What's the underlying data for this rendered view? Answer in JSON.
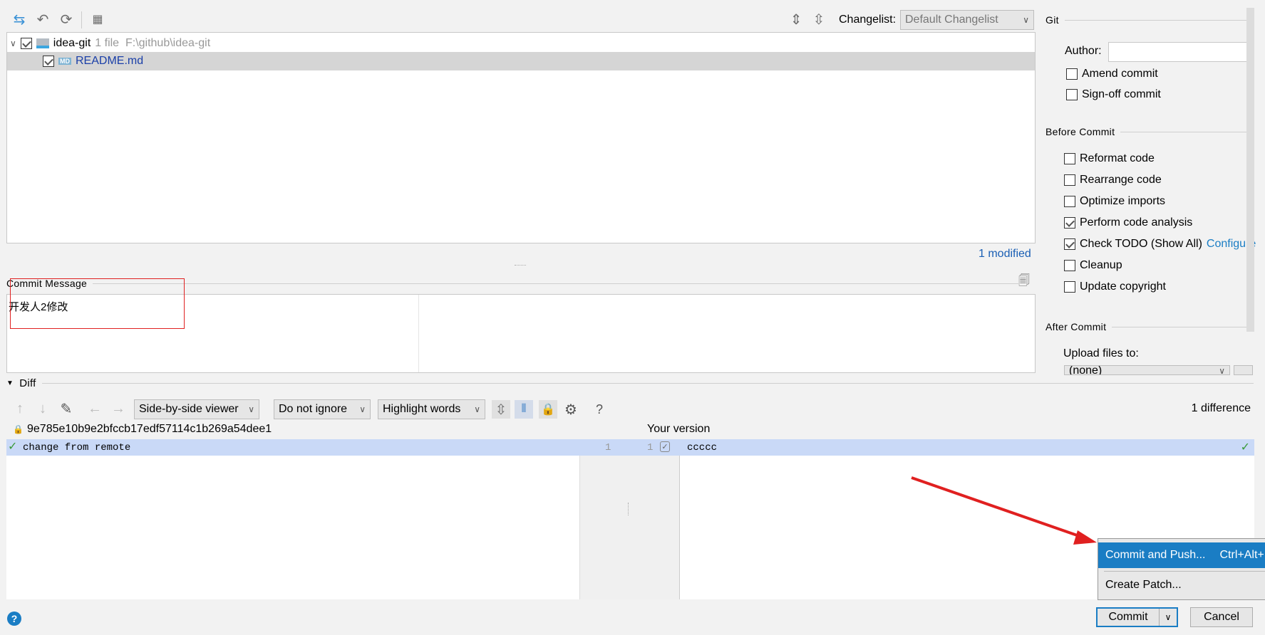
{
  "toolbar": {
    "icons": [
      "show-diff-icon",
      "rollback-icon",
      "refresh-icon",
      "group-by-icon"
    ],
    "expand_icon": "expand-all-icon",
    "collapse_icon": "collapse-all-icon",
    "changelist_label": "Changelist:",
    "changelist_value": "Default Changelist"
  },
  "tree": {
    "root": {
      "name": "idea-git",
      "info": "1 file  F:\\github\\idea-git",
      "checked": true
    },
    "files": [
      {
        "name": "README.md",
        "checked": true
      }
    ],
    "status": "1 modified"
  },
  "commit_message": {
    "label": "Commit Message",
    "value": "开发人2修改"
  },
  "git": {
    "title": "Git",
    "author_label": "Author:",
    "author_value": "",
    "options": [
      {
        "label": "Amend commit",
        "checked": false
      },
      {
        "label": "Sign-off commit",
        "checked": false
      }
    ]
  },
  "before_commit": {
    "title": "Before Commit",
    "options": [
      {
        "label": "Reformat code",
        "checked": false
      },
      {
        "label": "Rearrange code",
        "checked": false
      },
      {
        "label": "Optimize imports",
        "checked": false
      },
      {
        "label": "Perform code analysis",
        "checked": true
      },
      {
        "label": "Check TODO (Show All)",
        "checked": true,
        "link": "Configure"
      },
      {
        "label": "Cleanup",
        "checked": false
      },
      {
        "label": "Update copyright",
        "checked": false
      }
    ]
  },
  "after_commit": {
    "title": "After Commit",
    "upload_label": "Upload files to:",
    "upload_value": "(none)"
  },
  "diff": {
    "title": "Diff",
    "viewer": "Side-by-side viewer",
    "ignore": "Do not ignore",
    "highlight": "Highlight words",
    "count": "1 difference",
    "left_header": "9e785e10b9e2bfccb17edf57114c1b269a54dee1",
    "right_header": "Your version",
    "left_line": "change from remote",
    "right_line": "ccccc",
    "left_num": "1",
    "right_num": "1"
  },
  "popup": {
    "items": [
      {
        "label": "Commit and Push...",
        "shortcut": "Ctrl+Alt+K"
      },
      {
        "label": "Create Patch..."
      }
    ]
  },
  "buttons": {
    "commit": "Commit",
    "cancel": "Cancel",
    "help": "?"
  },
  "colors": {
    "accent": "#1a7dc4",
    "selection": "#c9d9f7",
    "annotation": "#e02020"
  }
}
